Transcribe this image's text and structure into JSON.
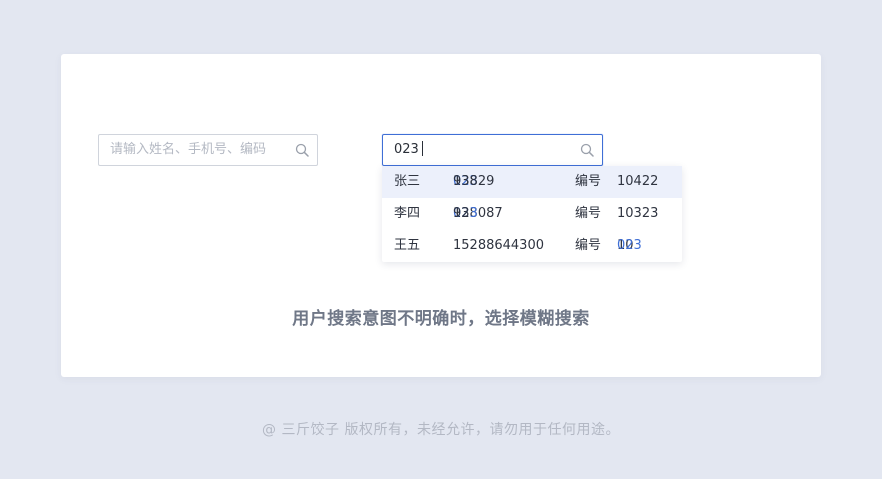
{
  "colors": {
    "page_bg": "#e3e7f1",
    "card_bg": "#ffffff",
    "accent": "#3f6fd6",
    "highlight_row": "#ecf0fb"
  },
  "search_idle": {
    "placeholder": "请输入姓名、手机号、编码",
    "icon": "search-icon"
  },
  "search_active": {
    "value": "023",
    "icon": "search-icon"
  },
  "results": [
    {
      "name": "张三",
      "phone_pre": "138",
      "phone_match": "023",
      "phone_post": "93829",
      "label": "编号",
      "code_pre": "10422",
      "code_match": "",
      "highlighted": true
    },
    {
      "name": "李四",
      "phone_pre": "138087",
      "phone_match": "023",
      "phone_post": "92",
      "label": "编号",
      "code_pre": "10323",
      "code_match": "",
      "highlighted": false
    },
    {
      "name": "王五",
      "phone_pre": "15288644300",
      "phone_match": "",
      "phone_post": "",
      "label": "编号",
      "code_pre": "10",
      "code_match": "023",
      "highlighted": false
    }
  ],
  "caption": "用户搜索意图不明确时，选择模糊搜索",
  "footer": "@ 三斤饺子  版权所有，未经允许，请勿用于任何用途。"
}
